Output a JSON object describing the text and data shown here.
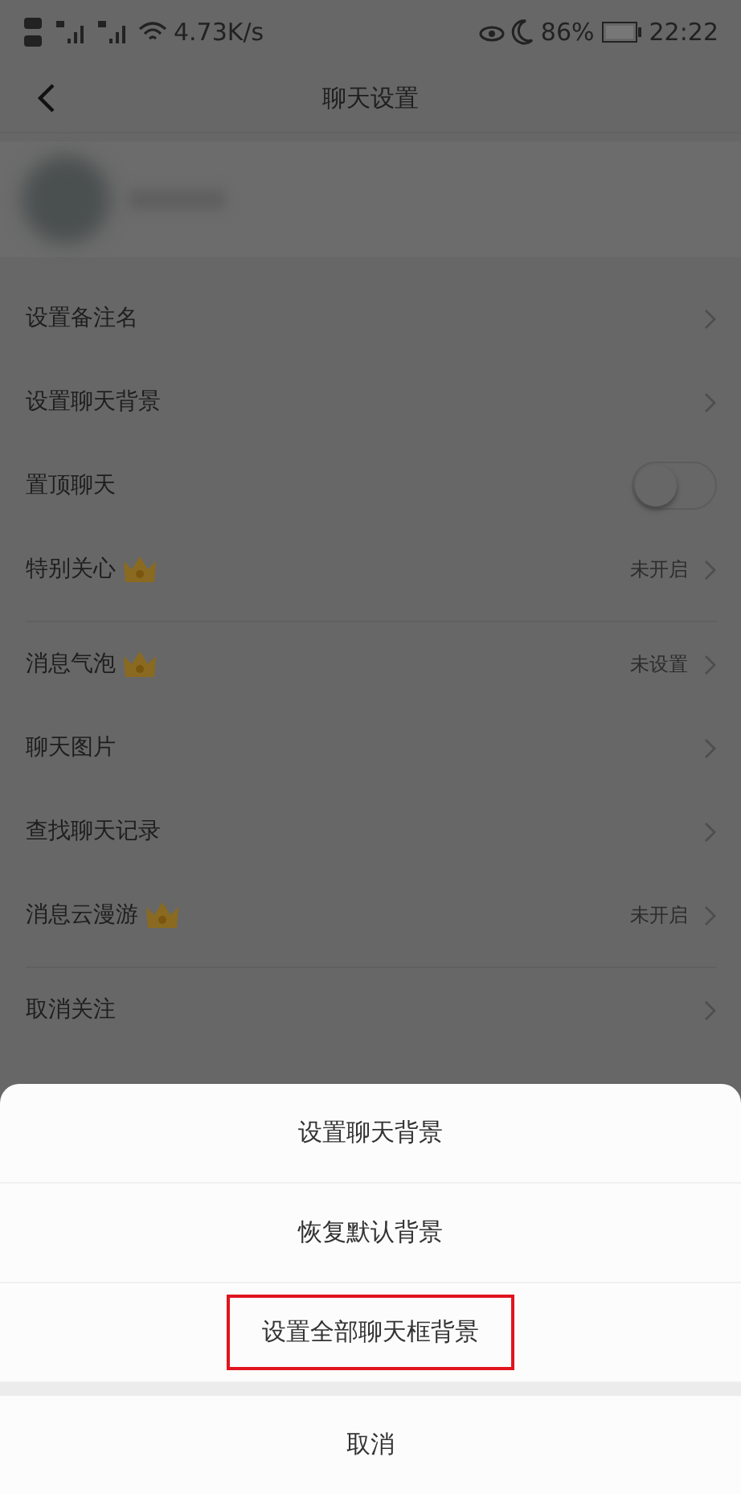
{
  "status_bar": {
    "speed": "4.73K/s",
    "battery": "86%",
    "time": "22:22"
  },
  "header": {
    "title": "聊天设置"
  },
  "groups": [
    {
      "rows": [
        {
          "label": "设置备注名",
          "kind": "link"
        },
        {
          "label": "设置聊天背景",
          "kind": "link"
        },
        {
          "label": "置顶聊天",
          "kind": "toggle",
          "on": false
        },
        {
          "label": "特别关心",
          "kind": "link",
          "crown": true,
          "value": "未开启"
        }
      ]
    },
    {
      "rows": [
        {
          "label": "消息气泡",
          "kind": "link",
          "crown": true,
          "value": "未设置"
        },
        {
          "label": "聊天图片",
          "kind": "link"
        },
        {
          "label": "查找聊天记录",
          "kind": "link"
        },
        {
          "label": "消息云漫游",
          "kind": "link",
          "crown": true,
          "value": "未开启"
        }
      ]
    },
    {
      "rows": [
        {
          "label": "取消关注",
          "kind": "link"
        }
      ]
    }
  ],
  "sheet": {
    "options": [
      {
        "label": "设置聊天背景",
        "highlighted": false
      },
      {
        "label": "恢复默认背景",
        "highlighted": false
      },
      {
        "label": "设置全部聊天框背景",
        "highlighted": true
      }
    ],
    "cancel": "取消"
  }
}
